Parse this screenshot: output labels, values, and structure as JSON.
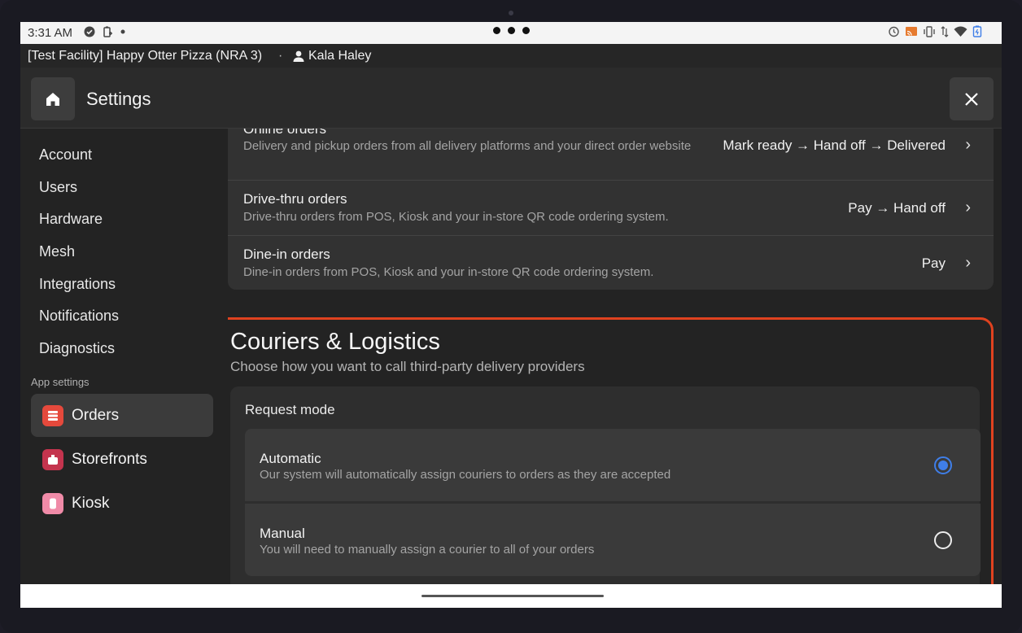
{
  "status_bar": {
    "time": "3:31 AM",
    "left_icons": [
      "check-circle-icon",
      "battery-saver-icon",
      "dot-icon"
    ],
    "right_icons": [
      "alarm-icon",
      "cast-icon",
      "vibrate-icon",
      "data-arrows-icon",
      "wifi-icon",
      "battery-icon"
    ]
  },
  "facility": {
    "name": "[Test Facility] Happy Otter Pizza (NRA 3)",
    "separator": "·",
    "user": "Kala Haley"
  },
  "header": {
    "title": "Settings"
  },
  "sidebar": {
    "items": [
      {
        "label": "Account"
      },
      {
        "label": "Users"
      },
      {
        "label": "Hardware"
      },
      {
        "label": "Mesh"
      },
      {
        "label": "Integrations"
      },
      {
        "label": "Notifications"
      },
      {
        "label": "Diagnostics"
      }
    ],
    "section_label": "App settings",
    "apps": [
      {
        "label": "Orders",
        "color": "#e5493c",
        "active": true
      },
      {
        "label": "Storefronts",
        "color": "#c4344e"
      },
      {
        "label": "Kiosk",
        "color": "#f08ba8"
      }
    ]
  },
  "orders": [
    {
      "title": "Online orders",
      "desc": "Delivery and pickup orders from all delivery platforms and your direct order website",
      "flow": "Mark ready → Hand off → Delivered"
    },
    {
      "title": "Drive-thru orders",
      "desc": "Drive-thru orders from POS, Kiosk and your in-store QR code ordering system.",
      "flow": "Pay → Hand off"
    },
    {
      "title": "Dine-in orders",
      "desc": "Dine-in orders from POS, Kiosk and your in-store QR code ordering system.",
      "flow": "Pay"
    }
  ],
  "couriers": {
    "title": "Couriers & Logistics",
    "subtitle": "Choose how you want to call third-party delivery providers",
    "request_mode_label": "Request mode",
    "options": [
      {
        "title": "Automatic",
        "desc": "Our system will automatically assign couriers to orders as they are accepted",
        "selected": true
      },
      {
        "title": "Manual",
        "desc": "You will need to manually assign a courier to all of your orders",
        "selected": false
      }
    ]
  },
  "colors": {
    "highlight": "#e0421f",
    "radio_selected": "#3f7ee8"
  }
}
